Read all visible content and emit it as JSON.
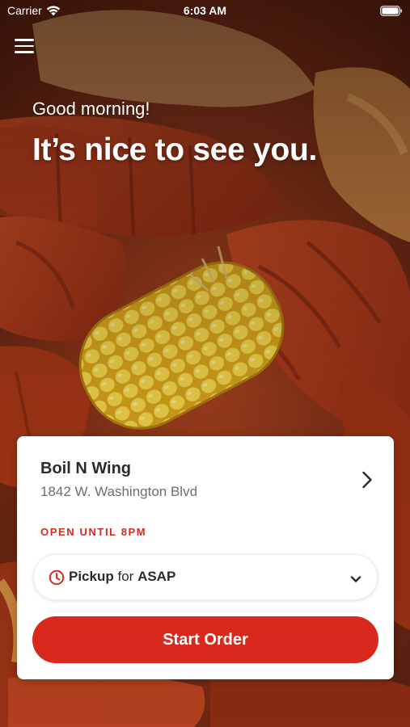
{
  "status_bar": {
    "carrier": "Carrier",
    "time": "6:03 AM"
  },
  "icons": {
    "menu": "hamburger-menu-icon",
    "wifi": "wifi-icon",
    "battery": "battery-icon",
    "chevron_right": "chevron-right-icon",
    "clock": "clock-icon",
    "chevron_down": "chevron-down-icon"
  },
  "hero": {
    "greeting": "Good morning!",
    "headline": "It’s nice to see you."
  },
  "store": {
    "name": "Boil N Wing",
    "address": "1842 W. Washington Blvd",
    "hours": "OPEN UNTIL 8PM"
  },
  "order_options": {
    "mode": "Pickup",
    "connector": "for",
    "time": "ASAP"
  },
  "actions": {
    "start_order_label": "Start Order"
  },
  "colors": {
    "accent": "#d9291c",
    "card": "#ffffff",
    "text_primary": "#2b2b2b",
    "text_secondary": "#6e6e6e"
  }
}
